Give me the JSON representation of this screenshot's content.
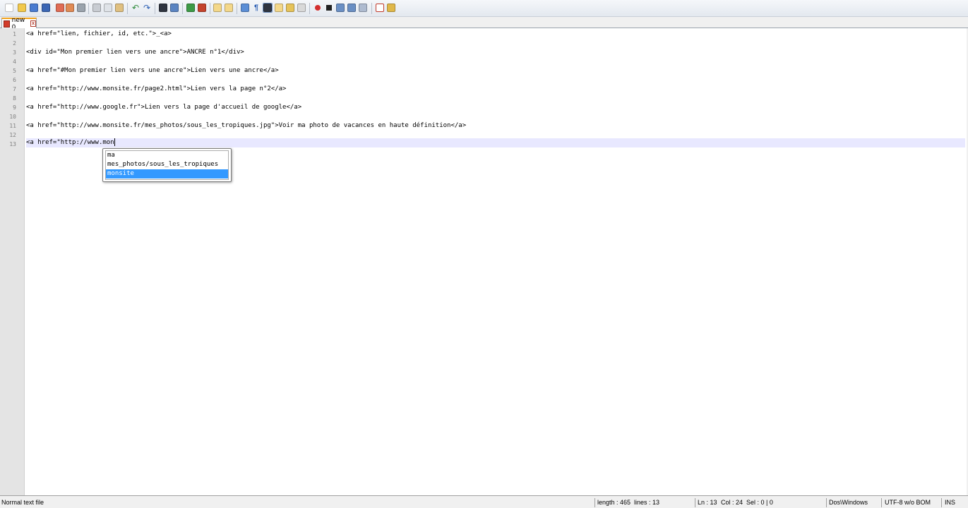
{
  "tab": {
    "label": "new 0"
  },
  "editor": {
    "line_numbers": [
      "1",
      "2",
      "3",
      "4",
      "5",
      "6",
      "7",
      "8",
      "9",
      "10",
      "11",
      "12",
      "13"
    ],
    "lines": [
      "<a href=\"lien, fichier, id, etc.\">_<a>",
      "",
      "<div id=\"Mon premier lien vers une ancre\">ANCRE n°1</div>",
      "",
      "<a href=\"#Mon premier lien vers une ancre\">Lien vers une ancre</a>",
      "",
      "<a href=\"http://www.monsite.fr/page2.html\">Lien vers la page n°2</a>",
      "",
      "<a href=\"http://www.google.fr\">Lien vers la page d'accueil de google</a>",
      "",
      "<a href=\"http://www.monsite.fr/mes_photos/sous_les_tropiques.jpg\">Voir ma photo de vacances en haute définition</a>",
      "",
      "<a href=\"http://www.mon"
    ]
  },
  "autocomplete": {
    "items": [
      "ma",
      "mes_photos/sous_les_tropiques",
      "monsite"
    ],
    "selected": "monsite",
    "selected_color": "#3399ff"
  },
  "statusbar": {
    "file_type": "Normal text file",
    "length": "length : 465",
    "lines": "lines : 13",
    "ln": "Ln : 13",
    "col": "Col : 24",
    "sel": "Sel : 0 | 0",
    "eol": "Dos\\Windows",
    "encoding": "UTF-8 w/o BOM",
    "mode": "INS"
  },
  "toolbar": {
    "icons": [
      "new-file-icon",
      "open-file-icon",
      "save-icon",
      "save-all-icon",
      "close-icon",
      "close-all-icon",
      "print-icon",
      "cut-icon",
      "copy-icon",
      "paste-icon",
      "undo-icon",
      "redo-icon",
      "find-icon",
      "replace-icon",
      "zoom-in-icon",
      "zoom-out-icon",
      "sync-vertical-icon",
      "sync-horizontal-icon",
      "word-wrap-icon",
      "show-all-chars-icon",
      "indent-guide-icon",
      "user-lang-icon",
      "doc-map-icon",
      "function-list-icon",
      "record-macro-icon",
      "stop-macro-icon",
      "play-macro-icon",
      "run-macro-multiple-icon",
      "save-macro-icon",
      "spellcheck-icon",
      "plugin-icon"
    ]
  },
  "colors": {
    "accent": "#3399ff",
    "current_line": "#e8e8ff",
    "gutter": "#e4e4e4"
  }
}
